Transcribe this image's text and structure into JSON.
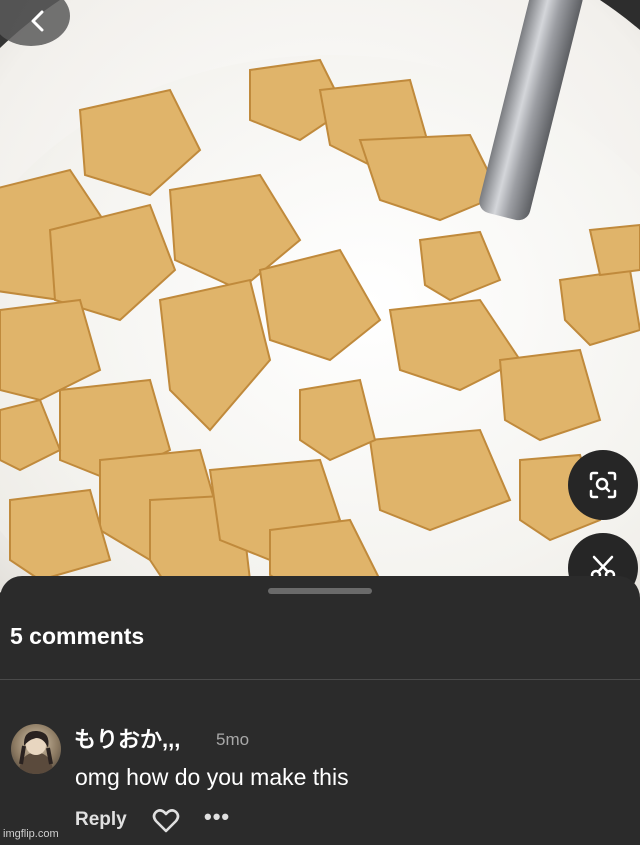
{
  "photo": {
    "subject_icon": "cereal-bowl-image",
    "back_icon": "chevron-left-icon",
    "lens_icon": "visual-search-icon",
    "scissors_icon": "scissors-icon"
  },
  "sheet": {
    "comments_count": "5 comments"
  },
  "comments": [
    {
      "username": "もりおか,,,",
      "time": "5mo",
      "text": "omg how do you make this",
      "reply_label": "Reply",
      "like_icon": "heart-outline-icon",
      "more_label": "•••"
    }
  ],
  "watermark": "imgflip.com"
}
